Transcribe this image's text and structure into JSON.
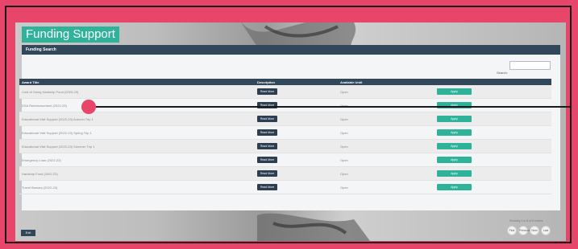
{
  "app": {
    "title": "Funding Support"
  },
  "panel": {
    "header": "Funding Search"
  },
  "search": {
    "label": "Search:",
    "value": ""
  },
  "table": {
    "columns": [
      "Award Title",
      "Description",
      "Available Until",
      ""
    ],
    "rows": [
      {
        "title": "Cost of Going Hardship Fund (2023-23)",
        "availability": "Open",
        "description_button": "Read More",
        "action_button": "Apply"
      },
      {
        "title": "DSA Reimbursement (2022-23)",
        "availability": "Open",
        "description_button": "Read More",
        "action_button": "Apply"
      },
      {
        "title": "Educational Visit Support (2022-23) Autumn Trip 1",
        "availability": "Open",
        "description_button": "Read More",
        "action_button": "Apply"
      },
      {
        "title": "Educational Visit Support (2022-23) Spring Trip 1",
        "availability": "Open",
        "description_button": "Read More",
        "action_button": "Apply"
      },
      {
        "title": "Educational Visit Support (2022-23) Summer Trip 1",
        "availability": "Open",
        "description_button": "Read More",
        "action_button": "Apply"
      },
      {
        "title": "Emergency Loan (2022-23)",
        "availability": "Open",
        "description_button": "Read More",
        "action_button": "Apply"
      },
      {
        "title": "Hardship Fund (2022-23)",
        "availability": "Open",
        "description_button": "Read More",
        "action_button": "Apply"
      },
      {
        "title": "Travel Bursary (2022-23)",
        "availability": "Open",
        "description_button": "Read More",
        "action_button": "Apply"
      }
    ]
  },
  "pagination": {
    "showing": "Showing 1 to 8 of 8 entries",
    "buttons": [
      "First",
      "Previous",
      "Next",
      "Last"
    ]
  },
  "footer": {
    "exit_label": "Exit"
  },
  "colors": {
    "page_bg": "#e8456a",
    "accent": "#2eb39a",
    "navy": "#33475b"
  }
}
